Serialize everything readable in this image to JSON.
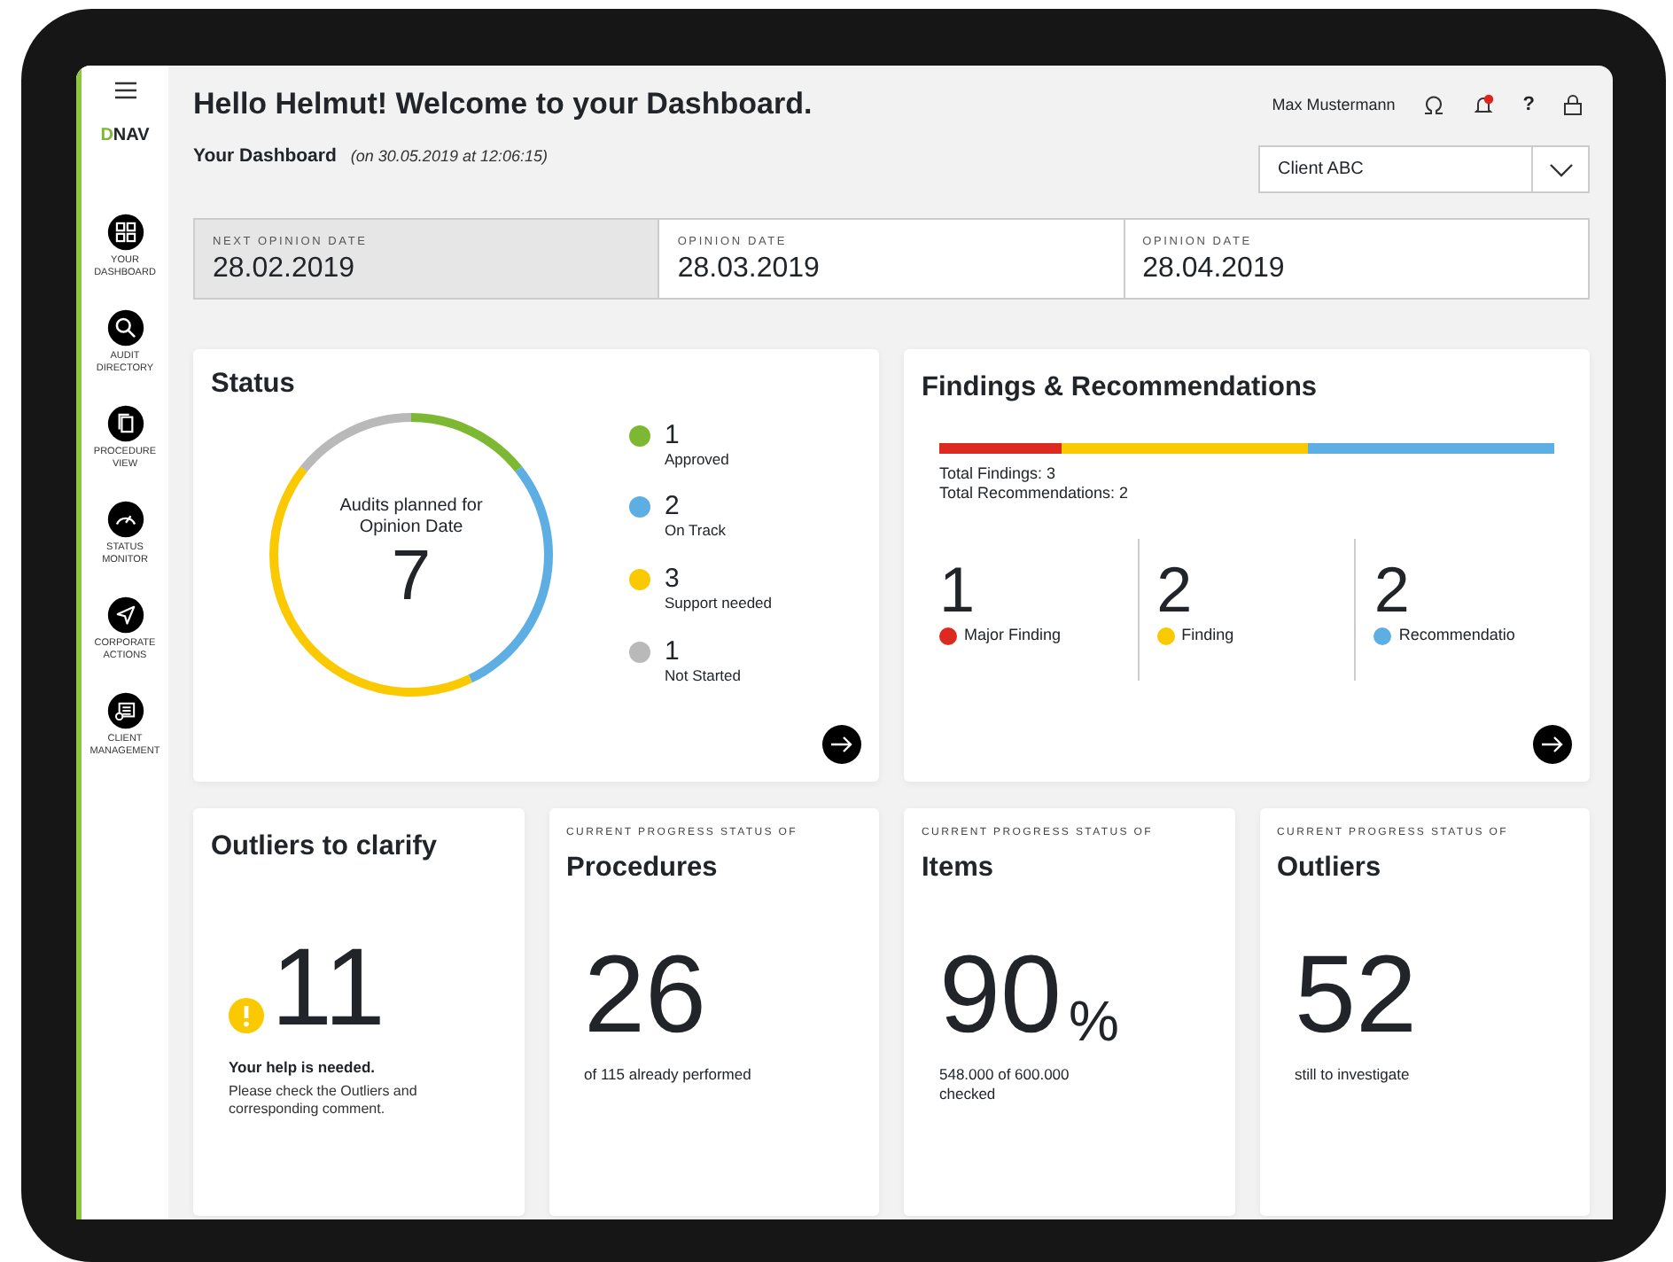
{
  "sidebar": {
    "logo": {
      "accent": "D",
      "rest": "NAV"
    },
    "items": [
      {
        "label": "YOUR DASHBOARD"
      },
      {
        "label": "AUDIT DIRECTORY"
      },
      {
        "label": "PROCEDURE VIEW"
      },
      {
        "label": "STATUS MONITOR"
      },
      {
        "label": "CORPORATE ACTIONS"
      },
      {
        "label": "CLIENT MANAGEMENT"
      }
    ]
  },
  "header": {
    "title": "Hello Helmut! Welcome to your Dashboard.",
    "user": "Max Mustermann",
    "help": "?",
    "notifications": true
  },
  "subheader": {
    "title": "Your Dashboard",
    "timestamp": "(on 30.05.2019 at 12:06:15)"
  },
  "client_select": {
    "value": "Client ABC"
  },
  "dates": [
    {
      "label": "NEXT OPINION DATE",
      "value": "28.02.2019",
      "selected": true
    },
    {
      "label": "OPINION DATE",
      "value": "28.03.2019",
      "selected": false
    },
    {
      "label": "OPINION DATE",
      "value": "28.04.2019",
      "selected": false
    }
  ],
  "status": {
    "title": "Status",
    "center_label": "Audits planned for Opinion Date",
    "center_value": "7",
    "chart_data": {
      "type": "donut",
      "categories": [
        "Approved",
        "On Track",
        "Support needed",
        "Not Started"
      ],
      "values": [
        14.3,
        28.6,
        42.8,
        14.3
      ]
    },
    "legend": [
      {
        "count": "1",
        "color": "#7cb832"
      },
      {
        "count": "2",
        "color": "#5daee3"
      },
      {
        "count": "3",
        "color": "#fbc900"
      },
      {
        "count": "1",
        "color": "#b9b9b9"
      }
    ]
  },
  "findings": {
    "title": "Findings & Recommendations",
    "totals": [
      "Total Findings: 3",
      "Total Recommendations: 2"
    ],
    "items": [
      {
        "count": "1",
        "label": "Major Finding",
        "color": "#dc2a20"
      },
      {
        "count": "2",
        "label": "Finding",
        "color": "#fbc900"
      },
      {
        "count": "2",
        "label": "Recommendatio",
        "color": "#5daee3"
      }
    ]
  },
  "outliers": {
    "title": "Outliers to clarify",
    "value": "11",
    "message": "Your help is needed.",
    "detail": "Please check the Outliers and corresponding comment."
  },
  "progress": [
    {
      "caption": "CURRENT PROGRESS STATUS OF",
      "title": "Procedures",
      "value": "26",
      "subtitle": "of 115 already performed"
    },
    {
      "caption": "CURRENT PROGRESS STATUS OF",
      "title": "Items",
      "value": "90",
      "unit": "%",
      "subtitle": "548.000 of 600.000 checked"
    },
    {
      "caption": "CURRENT PROGRESS STATUS OF",
      "title": "Outliers",
      "value": "52",
      "subtitle": "still to investigate"
    }
  ]
}
